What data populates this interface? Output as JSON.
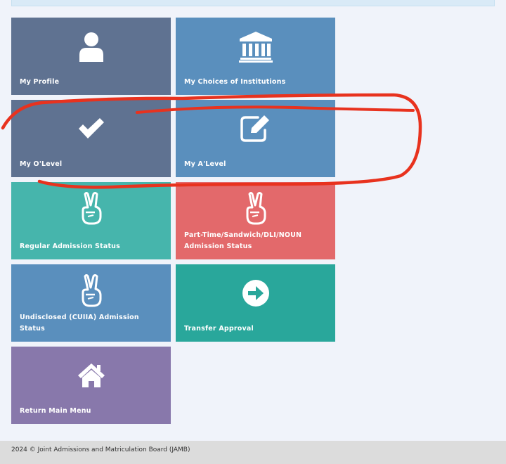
{
  "tiles": [
    {
      "key": "profile",
      "label": "My Profile",
      "icon": "user-icon",
      "color": "#5f7291"
    },
    {
      "key": "choices",
      "label": "My Choices of Institutions",
      "icon": "institution-icon",
      "color": "#5a8fbd"
    },
    {
      "key": "olevel",
      "label": "My O'Level",
      "icon": "checkmark-icon",
      "color": "#5f7291"
    },
    {
      "key": "alevel",
      "label": "My A'Level",
      "icon": "edit-icon",
      "color": "#5a8fbd"
    },
    {
      "key": "regular_status",
      "label": "Regular Admission Status",
      "icon": "victory-hand-icon",
      "color": "#46b5ac"
    },
    {
      "key": "parttime_status",
      "label": "Part-Time/Sandwich/DLI/NOUN Admission Status",
      "icon": "victory-hand-icon",
      "color": "#e3696b"
    },
    {
      "key": "undisclosed_status",
      "label": "Undisclosed (CUIIA) Admission Status",
      "icon": "victory-hand-icon",
      "color": "#5a8fbd"
    },
    {
      "key": "transfer",
      "label": "Transfer Approval",
      "icon": "arrow-right-circle-icon",
      "color": "#29a79b"
    },
    {
      "key": "main_menu",
      "label": "Return Main Menu",
      "icon": "home-icon",
      "color": "#8878ab"
    }
  ],
  "footer": {
    "copyright": "2024 © Joint Admissions and Matriculation Board (JAMB)"
  },
  "annotation": {
    "color": "#e8321e"
  }
}
